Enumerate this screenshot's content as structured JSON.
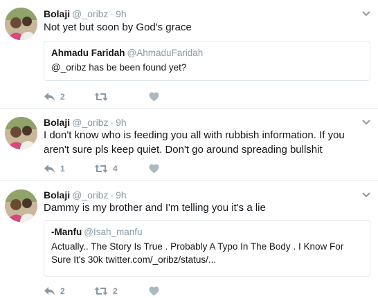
{
  "tweets": [
    {
      "name": "Bolaji",
      "handle": "@_oribz",
      "dot": "·",
      "time": "9h",
      "text": "Not yet but soon by God's grace",
      "quote": {
        "name": "Ahmadu Faridah",
        "handle": "@AhmaduFaridah",
        "text": "@_oribz has be been found yet?"
      },
      "reply_count": "2",
      "retweet_count": "",
      "like_count": ""
    },
    {
      "name": "Bolaji",
      "handle": "@_oribz",
      "dot": "·",
      "time": "9h",
      "text": "I don't know who is feeding you all with rubbish information. If you aren't sure pls keep quiet. Don't go around spreading bullshit",
      "reply_count": "1",
      "retweet_count": "4",
      "like_count": ""
    },
    {
      "name": "Bolaji",
      "handle": "@_oribz",
      "dot": "·",
      "time": "9h",
      "text": "Dammy is my brother and I'm telling you it's a lie",
      "quote": {
        "name": "-Manfu",
        "handle": "@Isah_manfu",
        "text": "Actually.. The Story Is True . Probably A Typo In The Body . I Know For Sure It's 30k twitter.com/_oribz/status/..."
      },
      "reply_count": "2",
      "retweet_count": "2",
      "like_count": ""
    }
  ],
  "icons": {
    "reply": "reply-icon",
    "retweet": "retweet-icon",
    "like": "heart-icon",
    "more": "chevron-down-icon"
  },
  "colors": {
    "text": "#14171a",
    "muted": "#8899a6",
    "border": "#e6ecf0"
  }
}
